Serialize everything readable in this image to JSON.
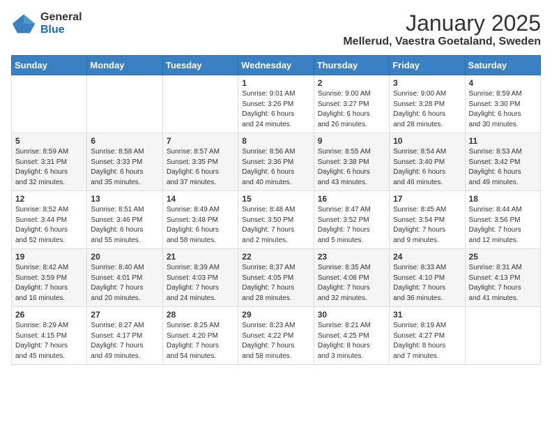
{
  "header": {
    "logo_general": "General",
    "logo_blue": "Blue",
    "month": "January 2025",
    "location": "Mellerud, Vaestra Goetaland, Sweden"
  },
  "weekdays": [
    "Sunday",
    "Monday",
    "Tuesday",
    "Wednesday",
    "Thursday",
    "Friday",
    "Saturday"
  ],
  "weeks": [
    [
      {
        "day": "",
        "info": ""
      },
      {
        "day": "",
        "info": ""
      },
      {
        "day": "",
        "info": ""
      },
      {
        "day": "1",
        "info": "Sunrise: 9:01 AM\nSunset: 3:26 PM\nDaylight: 6 hours\nand 24 minutes."
      },
      {
        "day": "2",
        "info": "Sunrise: 9:00 AM\nSunset: 3:27 PM\nDaylight: 6 hours\nand 26 minutes."
      },
      {
        "day": "3",
        "info": "Sunrise: 9:00 AM\nSunset: 3:28 PM\nDaylight: 6 hours\nand 28 minutes."
      },
      {
        "day": "4",
        "info": "Sunrise: 8:59 AM\nSunset: 3:30 PM\nDaylight: 6 hours\nand 30 minutes."
      }
    ],
    [
      {
        "day": "5",
        "info": "Sunrise: 8:59 AM\nSunset: 3:31 PM\nDaylight: 6 hours\nand 32 minutes."
      },
      {
        "day": "6",
        "info": "Sunrise: 8:58 AM\nSunset: 3:33 PM\nDaylight: 6 hours\nand 35 minutes."
      },
      {
        "day": "7",
        "info": "Sunrise: 8:57 AM\nSunset: 3:35 PM\nDaylight: 6 hours\nand 37 minutes."
      },
      {
        "day": "8",
        "info": "Sunrise: 8:56 AM\nSunset: 3:36 PM\nDaylight: 6 hours\nand 40 minutes."
      },
      {
        "day": "9",
        "info": "Sunrise: 8:55 AM\nSunset: 3:38 PM\nDaylight: 6 hours\nand 43 minutes."
      },
      {
        "day": "10",
        "info": "Sunrise: 8:54 AM\nSunset: 3:40 PM\nDaylight: 6 hours\nand 46 minutes."
      },
      {
        "day": "11",
        "info": "Sunrise: 8:53 AM\nSunset: 3:42 PM\nDaylight: 6 hours\nand 49 minutes."
      }
    ],
    [
      {
        "day": "12",
        "info": "Sunrise: 8:52 AM\nSunset: 3:44 PM\nDaylight: 6 hours\nand 52 minutes."
      },
      {
        "day": "13",
        "info": "Sunrise: 8:51 AM\nSunset: 3:46 PM\nDaylight: 6 hours\nand 55 minutes."
      },
      {
        "day": "14",
        "info": "Sunrise: 8:49 AM\nSunset: 3:48 PM\nDaylight: 6 hours\nand 58 minutes."
      },
      {
        "day": "15",
        "info": "Sunrise: 8:48 AM\nSunset: 3:50 PM\nDaylight: 7 hours\nand 2 minutes."
      },
      {
        "day": "16",
        "info": "Sunrise: 8:47 AM\nSunset: 3:52 PM\nDaylight: 7 hours\nand 5 minutes."
      },
      {
        "day": "17",
        "info": "Sunrise: 8:45 AM\nSunset: 3:54 PM\nDaylight: 7 hours\nand 9 minutes."
      },
      {
        "day": "18",
        "info": "Sunrise: 8:44 AM\nSunset: 3:56 PM\nDaylight: 7 hours\nand 12 minutes."
      }
    ],
    [
      {
        "day": "19",
        "info": "Sunrise: 8:42 AM\nSunset: 3:59 PM\nDaylight: 7 hours\nand 16 minutes."
      },
      {
        "day": "20",
        "info": "Sunrise: 8:40 AM\nSunset: 4:01 PM\nDaylight: 7 hours\nand 20 minutes."
      },
      {
        "day": "21",
        "info": "Sunrise: 8:39 AM\nSunset: 4:03 PM\nDaylight: 7 hours\nand 24 minutes."
      },
      {
        "day": "22",
        "info": "Sunrise: 8:37 AM\nSunset: 4:05 PM\nDaylight: 7 hours\nand 28 minutes."
      },
      {
        "day": "23",
        "info": "Sunrise: 8:35 AM\nSunset: 4:08 PM\nDaylight: 7 hours\nand 32 minutes."
      },
      {
        "day": "24",
        "info": "Sunrise: 8:33 AM\nSunset: 4:10 PM\nDaylight: 7 hours\nand 36 minutes."
      },
      {
        "day": "25",
        "info": "Sunrise: 8:31 AM\nSunset: 4:13 PM\nDaylight: 7 hours\nand 41 minutes."
      }
    ],
    [
      {
        "day": "26",
        "info": "Sunrise: 8:29 AM\nSunset: 4:15 PM\nDaylight: 7 hours\nand 45 minutes."
      },
      {
        "day": "27",
        "info": "Sunrise: 8:27 AM\nSunset: 4:17 PM\nDaylight: 7 hours\nand 49 minutes."
      },
      {
        "day": "28",
        "info": "Sunrise: 8:25 AM\nSunset: 4:20 PM\nDaylight: 7 hours\nand 54 minutes."
      },
      {
        "day": "29",
        "info": "Sunrise: 8:23 AM\nSunset: 4:22 PM\nDaylight: 7 hours\nand 58 minutes."
      },
      {
        "day": "30",
        "info": "Sunrise: 8:21 AM\nSunset: 4:25 PM\nDaylight: 8 hours\nand 3 minutes."
      },
      {
        "day": "31",
        "info": "Sunrise: 8:19 AM\nSunset: 4:27 PM\nDaylight: 8 hours\nand 7 minutes."
      },
      {
        "day": "",
        "info": ""
      }
    ]
  ]
}
